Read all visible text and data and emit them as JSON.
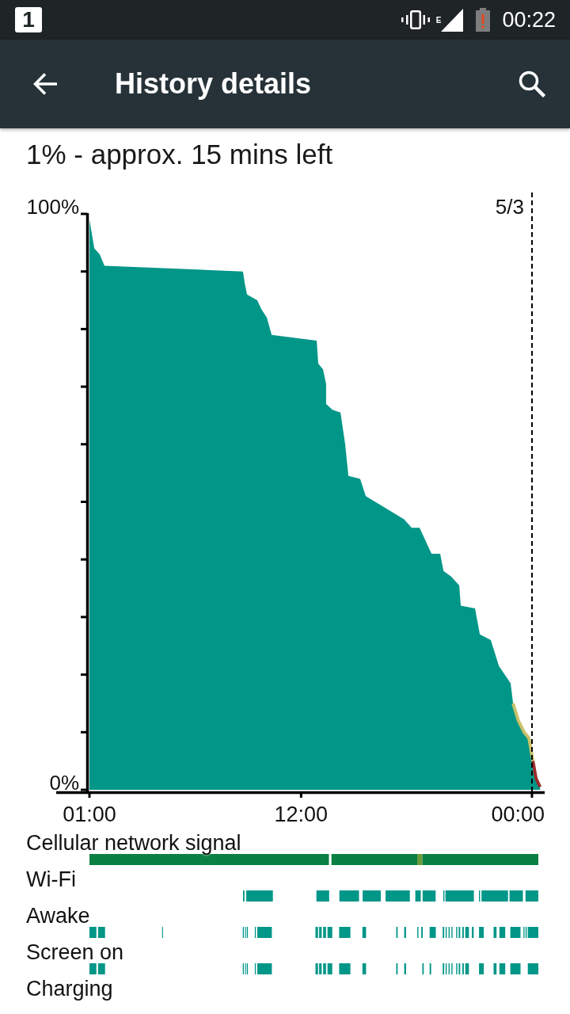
{
  "status_bar": {
    "notification": "1",
    "network_type": "E",
    "time": "00:22"
  },
  "app_bar": {
    "title": "History details"
  },
  "summary": "1% - approx. 15 mins left",
  "battery_chart": {
    "chart_data": {
      "type": "area",
      "x": [
        1,
        1.25,
        1.53,
        1.78,
        8.98,
        9.07,
        9.19,
        9.72,
        9.93,
        10.22,
        10.47,
        12.81,
        12.89,
        13.14,
        13.3,
        13.3,
        13.63,
        14.05,
        14.29,
        14.46,
        15.07,
        15.36,
        17.34,
        17.75,
        18.16,
        18.57,
        18.78,
        19.23,
        19.4,
        19.81,
        20.22,
        20.3,
        21.04,
        21.29,
        21.86,
        22.28,
        22.69,
        22.89,
        23.02,
        23.3,
        23.59,
        23.84,
        24.05,
        24.21,
        24.42
      ],
      "values": [
        99,
        94,
        93,
        91,
        90,
        88,
        86,
        85,
        83.5,
        82,
        79,
        78,
        74,
        73,
        70.5,
        67,
        66,
        65.5,
        60,
        54.5,
        54,
        51,
        47,
        45.5,
        45.5,
        42.5,
        41,
        41,
        38,
        37,
        35.5,
        32,
        31.5,
        27,
        26,
        21.5,
        19.5,
        18.5,
        15,
        12,
        10,
        9,
        5,
        2,
        0.5
      ],
      "xlim": [
        1,
        24.66
      ],
      "ylim": [
        0,
        100
      ],
      "xticks": [
        {
          "value": 1,
          "label": "01:00"
        },
        {
          "value": 12,
          "label": "12:00"
        },
        {
          "value": 24,
          "label": "00:00"
        }
      ],
      "yticks": [
        {
          "value": 0,
          "label": "0%"
        },
        {
          "value": 100,
          "label": "100%"
        }
      ],
      "annotations": [
        "5/3"
      ]
    }
  },
  "tracks": [
    {
      "label": "Cellular network signal",
      "kind": "signal"
    },
    {
      "label": "Wi-Fi",
      "kind": "wifi"
    },
    {
      "label": "Awake",
      "kind": "awake"
    },
    {
      "label": "Screen on",
      "kind": "screen"
    },
    {
      "label": "Charging",
      "kind": "charging"
    }
  ]
}
